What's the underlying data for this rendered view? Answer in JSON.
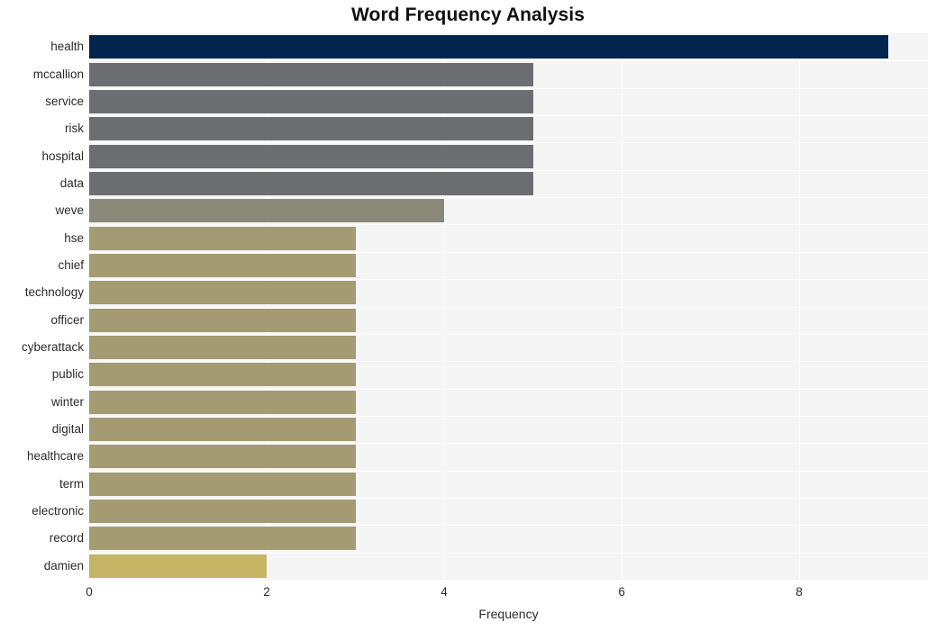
{
  "chart_data": {
    "type": "bar",
    "orientation": "horizontal",
    "title": "Word Frequency Analysis",
    "xlabel": "Frequency",
    "ylabel": "",
    "categories": [
      "health",
      "mccallion",
      "service",
      "risk",
      "hospital",
      "data",
      "weve",
      "hse",
      "chief",
      "technology",
      "officer",
      "cyberattack",
      "public",
      "winter",
      "digital",
      "healthcare",
      "term",
      "electronic",
      "record",
      "damien"
    ],
    "values": [
      9,
      5,
      5,
      5,
      5,
      5,
      4,
      3,
      3,
      3,
      3,
      3,
      3,
      3,
      3,
      3,
      3,
      3,
      3,
      2
    ],
    "bar_colors": [
      "#03244d",
      "#6d6e71",
      "#6d6e71",
      "#6d6e71",
      "#6d6e71",
      "#6d6e71",
      "#8a8878",
      "#a49b73",
      "#a49b73",
      "#a49b73",
      "#a49b73",
      "#a49b73",
      "#a49b73",
      "#a49b73",
      "#a49b73",
      "#a49b73",
      "#a49b73",
      "#a49b73",
      "#a49b73",
      "#c4b464"
    ],
    "xlim": [
      0,
      9.45
    ],
    "ylim": [
      0,
      20
    ],
    "xticks": [
      0,
      2,
      4,
      6,
      8
    ],
    "xtick_labels": [
      "0",
      "2",
      "4",
      "6",
      "8"
    ],
    "grid": true,
    "gridline_color": "#ffffff",
    "plot_background": "#f5f5f6",
    "figure_background": "#ffffff",
    "legend": null,
    "legend_position": "none"
  }
}
